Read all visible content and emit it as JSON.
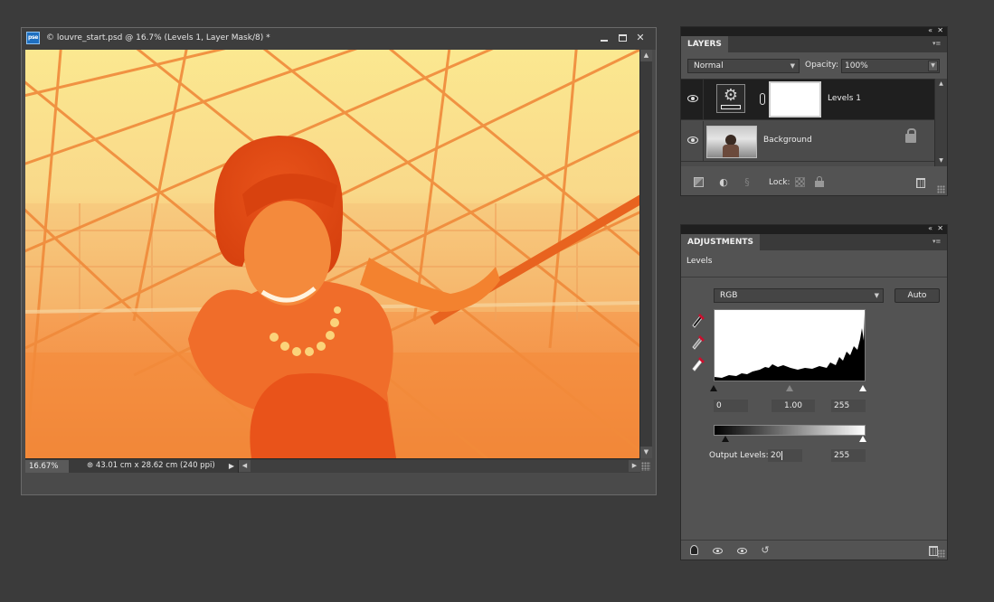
{
  "document": {
    "app_badge": "pse",
    "title": "© louvre_start.psd @ 16.7% (Levels 1, Layer Mask/8) *",
    "zoom": "16.67%",
    "info": "⊛ 43.01 cm x 28.62 cm (240 ppi)"
  },
  "layers_panel": {
    "tab": "LAYERS",
    "blend_mode": "Normal",
    "opacity_label": "Opacity:",
    "opacity_value": "100%",
    "lock_label": "Lock:",
    "layers": [
      {
        "name": "Levels 1",
        "selected": true
      },
      {
        "name": "Background",
        "locked": true
      }
    ]
  },
  "adjustments_panel": {
    "tab": "ADJUSTMENTS",
    "subtitle": "Levels",
    "channel": "RGB",
    "auto_label": "Auto",
    "input_black": "0",
    "input_gamma": "1.00",
    "input_white": "255",
    "output_label": "Output Levels:",
    "output_black": "20",
    "output_white": "255"
  },
  "colors": {
    "app_bg": "#3b3b3b",
    "panel_bg": "#535353",
    "selected_row": "#1f1f1f",
    "photo_tint_top": "#fbe890",
    "photo_tint_bottom": "#f08236"
  },
  "icons": {
    "panel_collapse": "«",
    "panel_close": "✕",
    "window_close": "✕",
    "dropdown": "▼",
    "scroll_up": "▲",
    "scroll_down": "▼",
    "scroll_left": "◀",
    "scroll_right": "▶",
    "panel_menu": "▾≡",
    "link": "§"
  }
}
